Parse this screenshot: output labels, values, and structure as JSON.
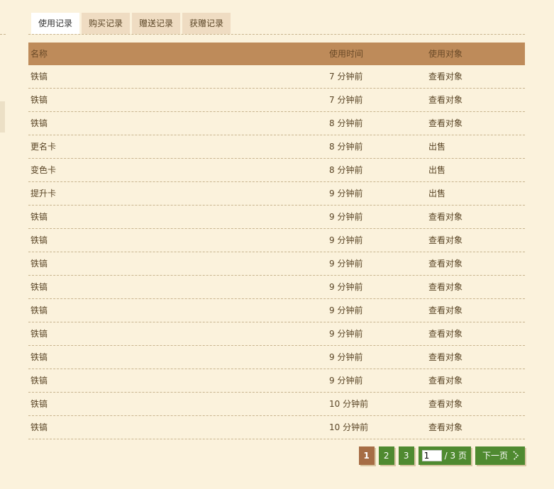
{
  "tabs": [
    {
      "label": "使用记录"
    },
    {
      "label": "购买记录"
    },
    {
      "label": "赠送记录"
    },
    {
      "label": "获赠记录"
    }
  ],
  "table": {
    "headers": {
      "name": "名称",
      "time": "使用时间",
      "target": "使用对象"
    },
    "rows": [
      {
        "name": "铁镐",
        "time": "7 分钟前",
        "action": "查看对象"
      },
      {
        "name": "铁镐",
        "time": "7 分钟前",
        "action": "查看对象"
      },
      {
        "name": "铁镐",
        "time": "8 分钟前",
        "action": "查看对象"
      },
      {
        "name": "更名卡",
        "time": "8 分钟前",
        "action": "出售"
      },
      {
        "name": "变色卡",
        "time": "8 分钟前",
        "action": "出售"
      },
      {
        "name": "提升卡",
        "time": "9 分钟前",
        "action": "出售"
      },
      {
        "name": "铁镐",
        "time": "9 分钟前",
        "action": "查看对象"
      },
      {
        "name": "铁镐",
        "time": "9 分钟前",
        "action": "查看对象"
      },
      {
        "name": "铁镐",
        "time": "9 分钟前",
        "action": "查看对象"
      },
      {
        "name": "铁镐",
        "time": "9 分钟前",
        "action": "查看对象"
      },
      {
        "name": "铁镐",
        "time": "9 分钟前",
        "action": "查看对象"
      },
      {
        "name": "铁镐",
        "time": "9 分钟前",
        "action": "查看对象"
      },
      {
        "name": "铁镐",
        "time": "9 分钟前",
        "action": "查看对象"
      },
      {
        "name": "铁镐",
        "time": "9 分钟前",
        "action": "查看对象"
      },
      {
        "name": "铁镐",
        "time": "10 分钟前",
        "action": "查看对象"
      },
      {
        "name": "铁镐",
        "time": "10 分钟前",
        "action": "查看对象"
      }
    ]
  },
  "pager": {
    "pages": [
      "1",
      "2",
      "3"
    ],
    "current_page": "1",
    "jump_value": "1",
    "total_label": "/ 3 页",
    "next_label": "下一页"
  },
  "colors": {
    "background": "#fbf2dc",
    "header": "#be8b5a",
    "pager_green": "#4f8a30",
    "pager_current": "#a66d45"
  },
  "icons": {
    "next": "chevron-right-icon"
  }
}
